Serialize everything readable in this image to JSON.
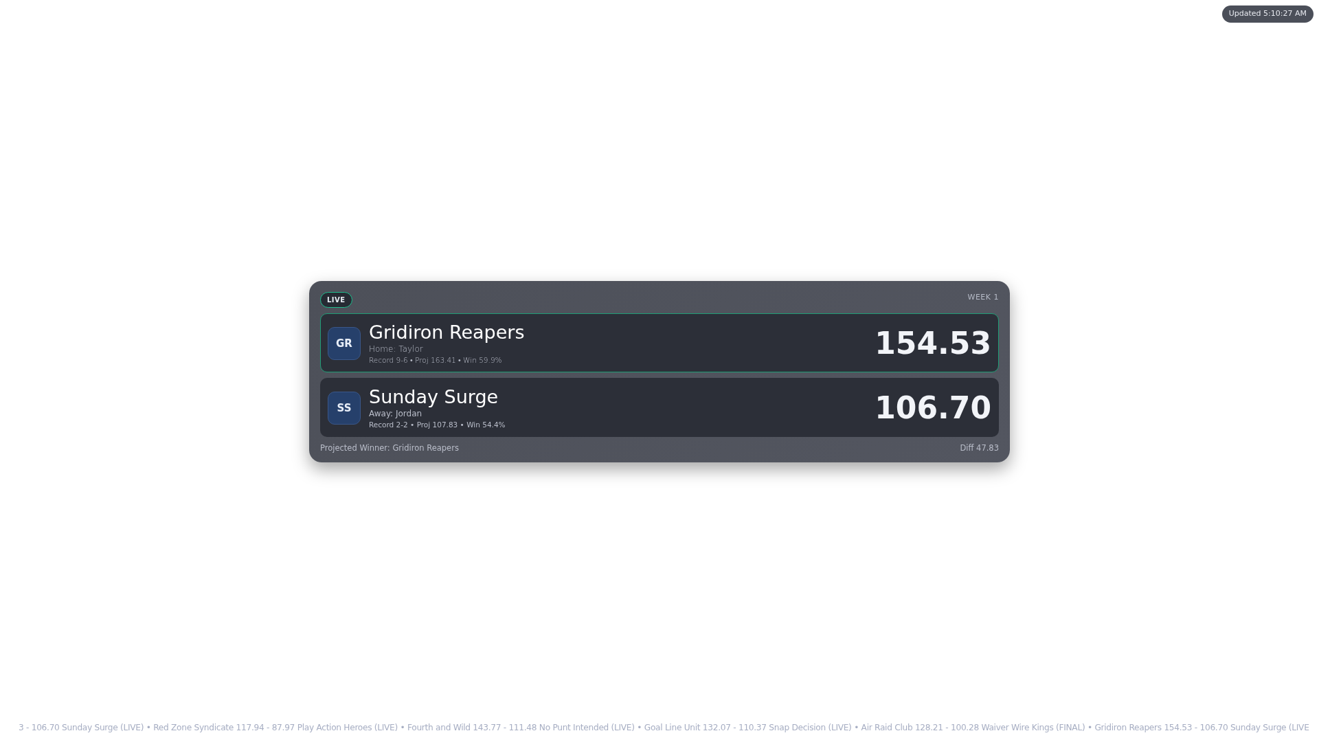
{
  "updated": "Updated 5:10:27 AM",
  "matchup": {
    "status": "LIVE",
    "week": "WEEK 1",
    "teams": [
      {
        "initials": "GR",
        "name": "Gridiron Reapers",
        "owner": "Home: Taylor",
        "stats": "Record 9-6 • Proj 163.41 • Win 59.9%",
        "score": "154.53",
        "leading": true
      },
      {
        "initials": "SS",
        "name": "Sunday Surge",
        "owner": "Away: Jordan",
        "stats": "Record 2-2 • Proj 107.83 • Win 54.4%",
        "score": "106.70",
        "leading": false
      }
    ],
    "projected_winner": "Projected Winner: Gridiron Reapers",
    "diff": "Diff 47.83"
  },
  "ticker": "3 - 106.70 Sunday Surge (LIVE) • Red Zone Syndicate 117.94 - 87.97 Play Action Heroes (LIVE) • Fourth and Wild 143.77 - 111.48 No Punt Intended (LIVE) • Goal Line Unit 132.07 - 110.37 Snap Decision (LIVE) • Air Raid Club 128.21 - 100.28 Waiver Wire Kings (FINAL) • Gridiron Reapers 154.53 - 106.70 Sunday Surge (LIVE"
}
